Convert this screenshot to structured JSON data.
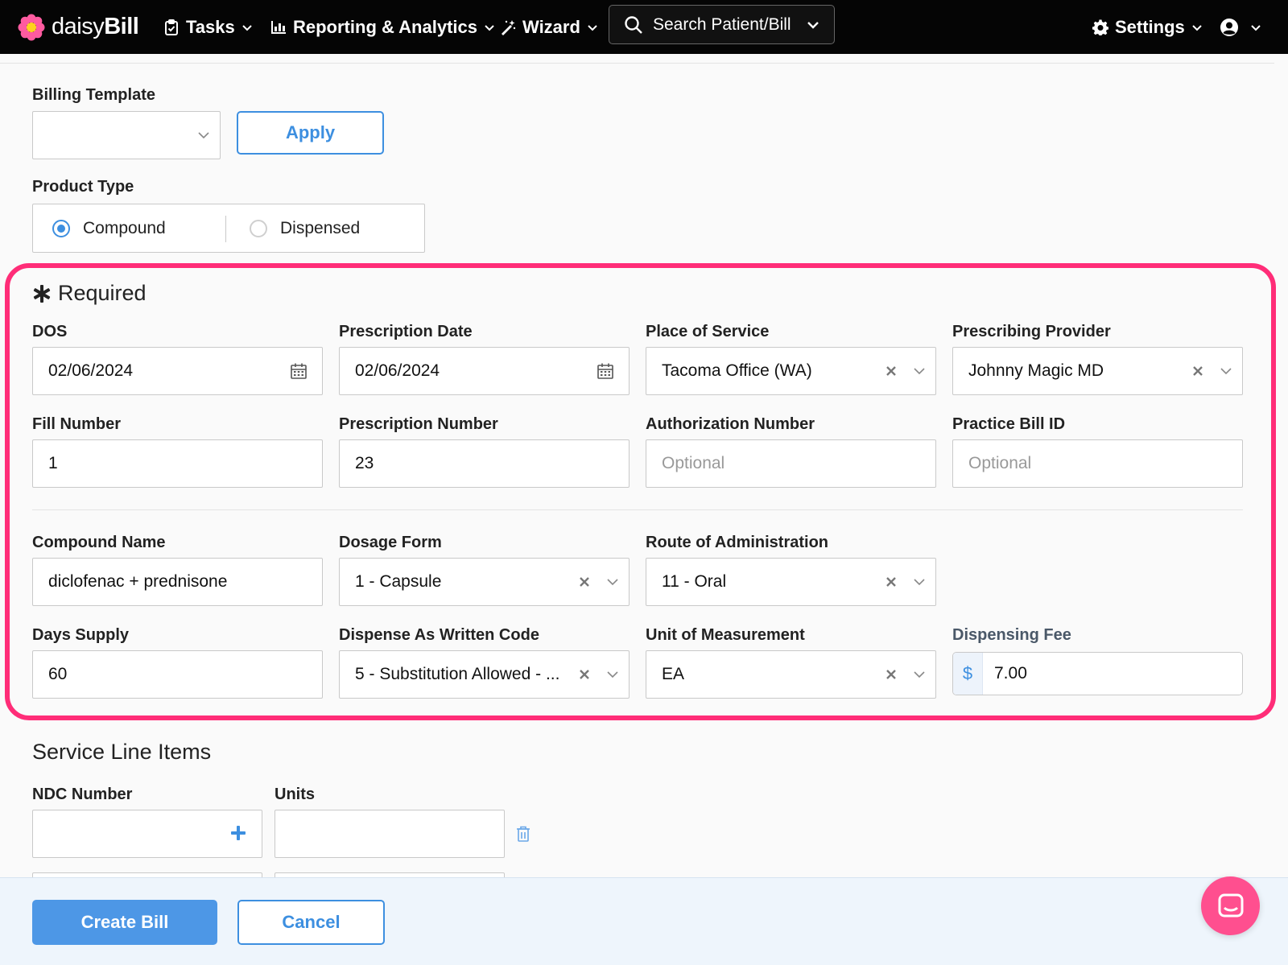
{
  "nav": {
    "brand": {
      "light": "daisy",
      "bold": "Bill"
    },
    "tasks": "Tasks",
    "reporting": "Reporting & Analytics",
    "wizard": "Wizard",
    "search": "Search Patient/Bill",
    "settings": "Settings"
  },
  "billing_template": {
    "label": "Billing Template",
    "value": "",
    "apply": "Apply"
  },
  "product_type": {
    "label": "Product Type",
    "options": [
      "Compound",
      "Dispensed"
    ],
    "selected": "Compound"
  },
  "required": {
    "title": "Required",
    "dos": {
      "label": "DOS",
      "value": "02/06/2024"
    },
    "prescription_date": {
      "label": "Prescription Date",
      "value": "02/06/2024"
    },
    "place_of_service": {
      "label": "Place of Service",
      "value": "Tacoma Office (WA)"
    },
    "prescribing_provider": {
      "label": "Prescribing Provider",
      "value": "Johnny Magic MD"
    },
    "fill_number": {
      "label": "Fill Number",
      "value": "1"
    },
    "prescription_number": {
      "label": "Prescription Number",
      "value": "23"
    },
    "authorization_number": {
      "label": "Authorization Number",
      "placeholder": "Optional"
    },
    "practice_bill_id": {
      "label": "Practice Bill ID",
      "placeholder": "Optional"
    },
    "compound_name": {
      "label": "Compound Name",
      "value": "diclofenac + prednisone"
    },
    "dosage_form": {
      "label": "Dosage Form",
      "value": "1 - Capsule"
    },
    "route": {
      "label": "Route of Administration",
      "value": "11 - Oral"
    },
    "days_supply": {
      "label": "Days Supply",
      "value": "60"
    },
    "daw_code": {
      "label": "Dispense As Written Code",
      "value": "5 - Substitution Allowed - ..."
    },
    "unit": {
      "label": "Unit of Measurement",
      "value": "EA"
    },
    "dispensing_fee": {
      "label": "Dispensing Fee",
      "prefix": "$",
      "value": "7.00"
    }
  },
  "service_lines": {
    "title": "Service Line Items",
    "ndc_label": "NDC Number",
    "units_label": "Units"
  },
  "footer": {
    "create": "Create Bill",
    "cancel": "Cancel"
  },
  "colors": {
    "accent": "#3d8fe0",
    "highlight": "#ff2d78",
    "chat": "#ff4f8f",
    "navbar": "#050505"
  }
}
